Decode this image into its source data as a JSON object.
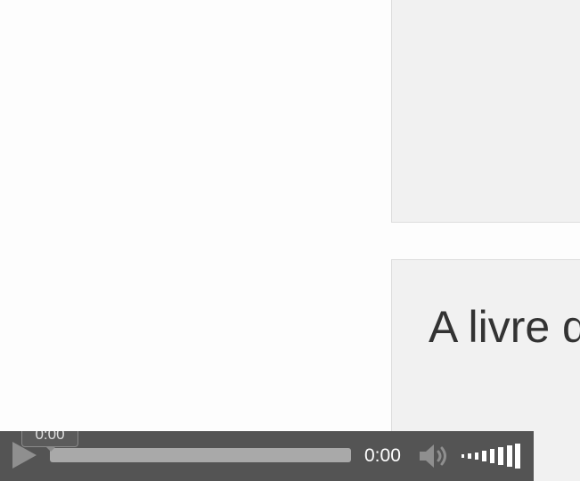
{
  "content": {
    "heading": "A livre d"
  },
  "player": {
    "current_time": "0:00",
    "tooltip_time": "0:00",
    "progress": 0,
    "volume_level": 1.0,
    "icons": {
      "play": "play-icon",
      "mute": "speaker-icon",
      "volume": "volume-bars-icon"
    },
    "colors": {
      "bar": "#545454",
      "track": "#a9a9a9",
      "icon": "#8f8f8f"
    }
  }
}
